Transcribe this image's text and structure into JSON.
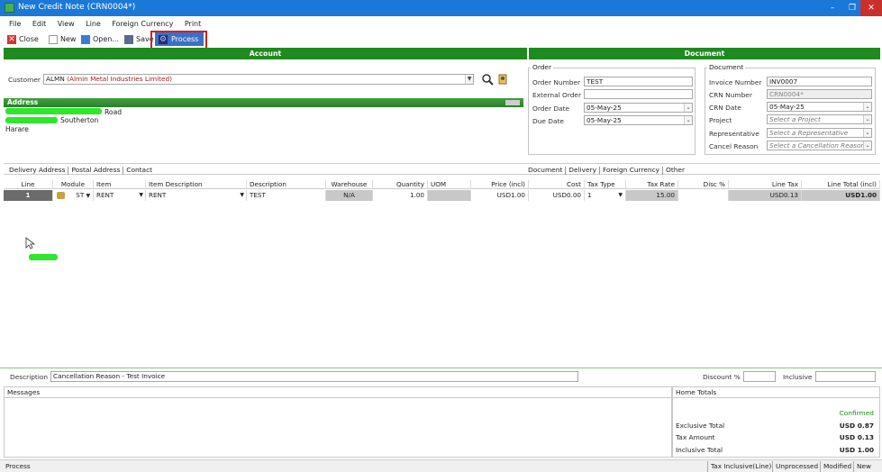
{
  "window": {
    "title": "New Credit Note (CRN0004*)",
    "min": "–",
    "max": "❐",
    "close": "✕"
  },
  "menu": [
    "File",
    "Edit",
    "View",
    "Line",
    "Foreign Currency",
    "Print"
  ],
  "toolbar": {
    "close": "Close",
    "new": "New",
    "open": "Open...",
    "save": "Save",
    "process": "Process"
  },
  "sections": {
    "account": "Account",
    "document": "Document",
    "address": "Address"
  },
  "customer": {
    "label": "Customer",
    "value": "ALMN",
    "name": "(Almin Metal Industries Limited)"
  },
  "address": {
    "line1_suffix": "Road",
    "line2_suffix": "Southerton",
    "line3": "Harare"
  },
  "order": {
    "title": "Order",
    "order_number_label": "Order Number",
    "order_number": "TEST",
    "external_order_label": "External Order",
    "external_order": "",
    "order_date_label": "Order Date",
    "order_date": "05-May-25",
    "due_date_label": "Due Date",
    "due_date": "05-May-25"
  },
  "document": {
    "title": "Document",
    "invoice_number_label": "Invoice Number",
    "invoice_number": "INV0007",
    "crn_number_label": "CRN Number",
    "crn_number": "CRN0004*",
    "crn_date_label": "CRN Date",
    "crn_date": "05-May-25",
    "project_label": "Project",
    "project_placeholder": "Select a Project",
    "representative_label": "Representative",
    "representative_placeholder": "Select a Representative",
    "cancel_reason_label": "Cancel Reason",
    "cancel_reason_placeholder": "Select a Cancellation Reason"
  },
  "left_tabs": [
    "Delivery Address",
    "Postal Address",
    "Contact"
  ],
  "right_tabs": [
    "Document",
    "Delivery",
    "Foreign Currency",
    "Other"
  ],
  "grid": {
    "columns": [
      "Line",
      "Module",
      "Item",
      "Item Description",
      "Description",
      "Warehouse",
      "Quantity",
      "UOM",
      "Price (incl)",
      "Cost",
      "Tax Type",
      "Tax Rate",
      "Disc %",
      "Line Tax",
      "Line Total (incl)"
    ],
    "row": {
      "line": "1",
      "module": "ST",
      "item": "RENT",
      "item_description": "RENT",
      "description": "TEST",
      "warehouse": "N/A",
      "quantity": "1.00",
      "uom": "",
      "price": "USD1.00",
      "cost": "USD0.00",
      "tax_type": "1",
      "tax_rate": "15.00",
      "disc": "",
      "line_tax": "USD0.13",
      "line_total": "USD1.00"
    }
  },
  "footer": {
    "description_label": "Description",
    "description_value": "Cancellation Reason - Test Invoice",
    "discount_label": "Discount %",
    "discount_value": "",
    "inclusive_label": "Inclusive",
    "inclusive_value": ""
  },
  "messages": {
    "title": "Messages"
  },
  "home_totals": {
    "title": "Home Totals",
    "status": "Confirmed",
    "exclusive_label": "Exclusive Total",
    "exclusive_value": "USD 0.87",
    "tax_label": "Tax Amount",
    "tax_value": "USD 0.13",
    "inclusive_label": "Inclusive Total",
    "inclusive_value": "USD 1.00"
  },
  "statusbar": {
    "left": "Process",
    "items": [
      "Tax Inclusive(Line)",
      "Unprocessed",
      "Modified",
      "New"
    ]
  },
  "colors": {
    "title_bar": "#1a79d8",
    "section_bar": "#1f8a1f",
    "highlight": "#d62020",
    "confirmed": "#1c8a1c"
  }
}
